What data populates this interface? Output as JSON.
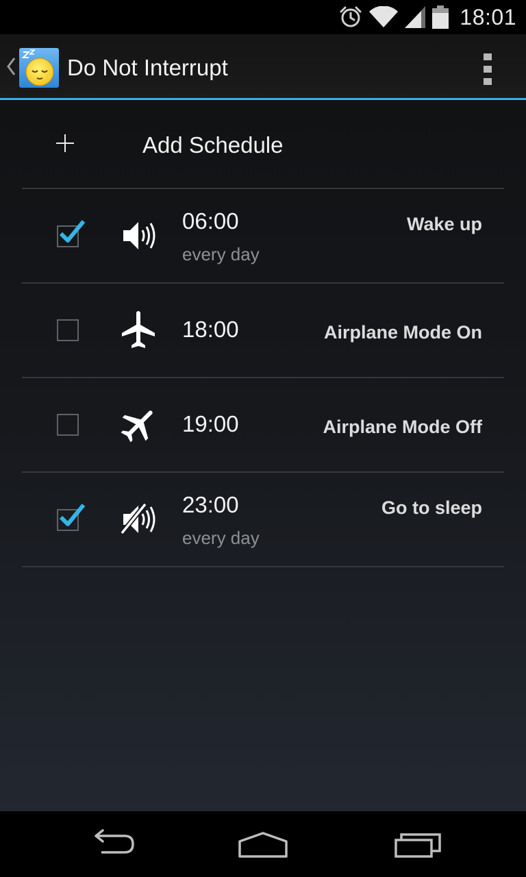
{
  "status_bar": {
    "clock": "18:01",
    "icons": [
      "alarm-icon",
      "wifi-icon",
      "cell-signal-icon",
      "battery-icon"
    ]
  },
  "action_bar": {
    "title": "Do Not Interrupt",
    "app_icon": "sleeping-face-icon",
    "up_icon": "up-caret-icon",
    "overflow_icon": "overflow-menu-icon"
  },
  "add_schedule": {
    "label": "Add Schedule",
    "icon": "plus-icon"
  },
  "schedules": [
    {
      "checked": true,
      "icon": "volume-on-icon",
      "time": "06:00",
      "repeat": "every day",
      "action": "Wake up"
    },
    {
      "checked": false,
      "icon": "airplane-icon",
      "time": "18:00",
      "repeat": "",
      "action": "Airplane Mode On"
    },
    {
      "checked": false,
      "icon": "airplane-tilted-icon",
      "time": "19:00",
      "repeat": "",
      "action": "Airplane Mode Off"
    },
    {
      "checked": true,
      "icon": "volume-muted-icon",
      "time": "23:00",
      "repeat": "every day",
      "action": "Go to sleep"
    }
  ],
  "nav_bar": {
    "back_icon": "back-icon",
    "home_icon": "home-icon",
    "recents_icon": "recents-icon"
  },
  "colors": {
    "accent": "#33b5e5",
    "background_top": "#111214",
    "background_bottom": "#232730",
    "divider": "#34383e"
  }
}
